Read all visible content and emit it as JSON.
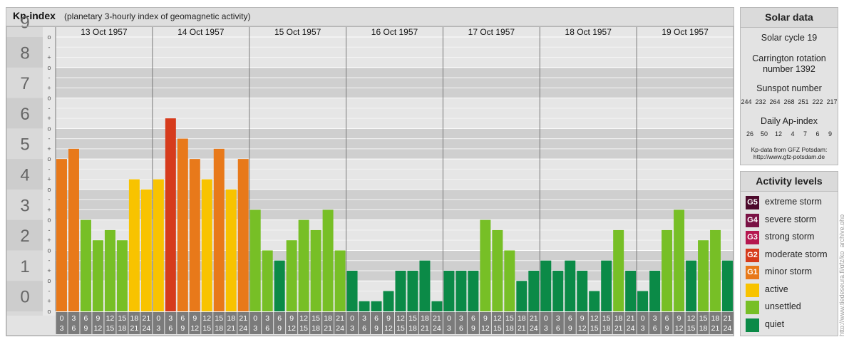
{
  "header": {
    "title": "Kp-index",
    "subtitle": "(planetary 3-hourly index of geomagnetic activity)"
  },
  "chart_data": {
    "type": "bar",
    "ylim": [
      0,
      9
    ],
    "y_major_ticks": [
      "0",
      "1",
      "2",
      "3",
      "4",
      "5",
      "6",
      "7",
      "8",
      "9"
    ],
    "y_minor_ticks": [
      "+",
      "o",
      "-"
    ],
    "days": [
      "13 Oct 1957",
      "14 Oct 1957",
      "15 Oct 1957",
      "16 Oct 1957",
      "17 Oct 1957",
      "18 Oct 1957",
      "19 Oct 1957"
    ],
    "interval_top": [
      "0",
      "3",
      "6",
      "9",
      "12",
      "15",
      "18",
      "21"
    ],
    "interval_bottom": [
      "3",
      "6",
      "9",
      "12",
      "15",
      "18",
      "21",
      "24"
    ],
    "values": [
      [
        5.0,
        5.333,
        3.0,
        2.333,
        2.667,
        2.333,
        4.333,
        4.0
      ],
      [
        4.333,
        6.333,
        5.667,
        5.0,
        4.333,
        5.333,
        4.0,
        5.0
      ],
      [
        3.333,
        2.0,
        1.667,
        2.333,
        3.0,
        2.667,
        3.333,
        2.0
      ],
      [
        1.333,
        0.333,
        0.333,
        0.667,
        1.333,
        1.333,
        1.667,
        0.333
      ],
      [
        1.333,
        1.333,
        1.333,
        3.0,
        2.667,
        2.0,
        1.0,
        1.333
      ],
      [
        1.667,
        1.333,
        1.667,
        1.333,
        0.667,
        1.667,
        2.667,
        1.333
      ],
      [
        0.667,
        1.333,
        2.667,
        3.333,
        1.667,
        2.333,
        2.667,
        1.667
      ]
    ],
    "category_colors": {
      "quiet": "#0b8a47",
      "unsettled": "#77bf26",
      "active": "#f8c300",
      "minor_storm": "#e8791a",
      "moderate_storm": "#d63b1c",
      "strong_storm": "#b5174f",
      "severe_storm": "#7a1245",
      "extreme_storm": "#4d0a2c"
    }
  },
  "solar": {
    "title": "Solar data",
    "cycle": "Solar cycle 19",
    "carrington_line1": "Carrington rotation",
    "carrington_line2": "number 1392",
    "sunspot_label": "Sunspot number",
    "sunspot_values": "244  232  264  268  251  222  217",
    "ap_label": "Daily Ap-index",
    "ap_values": "26    50    12     4     7     6     9",
    "source_line1": "Kp-data from GFZ Potsdam:",
    "source_line2": "http://www.gfz-potsdam.de"
  },
  "levels": {
    "title": "Activity levels",
    "items": [
      {
        "badge": "G5",
        "label": "extreme storm",
        "color": "#4d0a2c"
      },
      {
        "badge": "G4",
        "label": "severe storm",
        "color": "#7a1245"
      },
      {
        "badge": "G3",
        "label": "strong storm",
        "color": "#b5174f"
      },
      {
        "badge": "G2",
        "label": "moderate storm",
        "color": "#d63b1c"
      },
      {
        "badge": "G1",
        "label": "minor storm",
        "color": "#e8791a"
      },
      {
        "badge": "",
        "label": "active",
        "color": "#f8c300"
      },
      {
        "badge": "",
        "label": "unsettled",
        "color": "#77bf26"
      },
      {
        "badge": "",
        "label": "quiet",
        "color": "#0b8a47"
      }
    ]
  },
  "watermark": "http://www.tiedeseura.fi/gfz/kp_archive.php"
}
